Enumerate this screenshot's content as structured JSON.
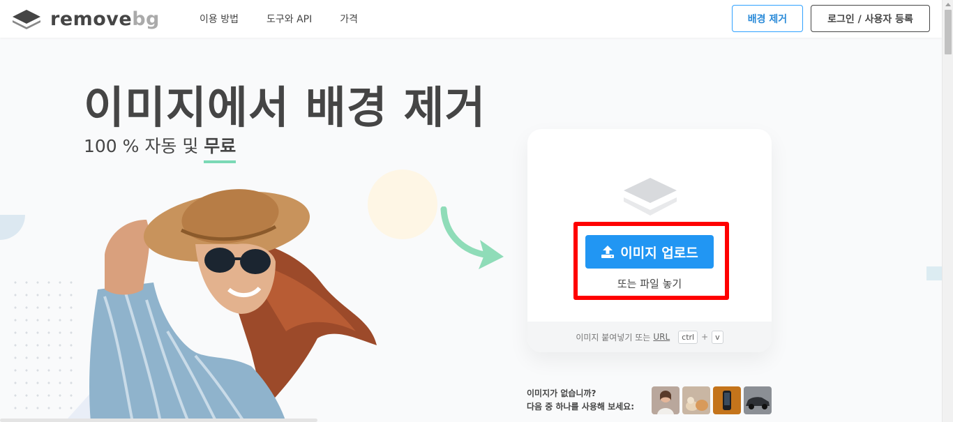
{
  "brand": {
    "name_a": "remove",
    "name_b": "bg"
  },
  "nav": [
    {
      "label": "이용 방법"
    },
    {
      "label": "도구와 API"
    },
    {
      "label": "가격"
    }
  ],
  "header_buttons": {
    "remove_bg": "배경 제거",
    "login": "로그인 / 사용자 등록"
  },
  "hero": {
    "title": "이미지에서 배경 제거",
    "subtitle_prefix": "100 % 자동 및 ",
    "subtitle_bold": "무료"
  },
  "upload": {
    "button_label": "이미지 업로드",
    "drop_text": "또는 파일 놓기",
    "paste_text": "이미지 붙여넣기 또는",
    "url_link": "URL",
    "key_ctrl": "ctrl",
    "key_plus": "+",
    "key_v": "v"
  },
  "samples": {
    "line1": "이미지가 없습니까?",
    "line2": "다음 중 하나를 사용해 보세요:"
  },
  "colors": {
    "primary": "#2196f3",
    "text": "#454545",
    "highlight": "#ff0000",
    "accent_green": "#7bd9b5"
  },
  "icons": {
    "logo": "layers-logo-icon",
    "upload": "upload-icon",
    "dropzone": "layers-icon",
    "arrow": "curved-arrow-icon"
  }
}
